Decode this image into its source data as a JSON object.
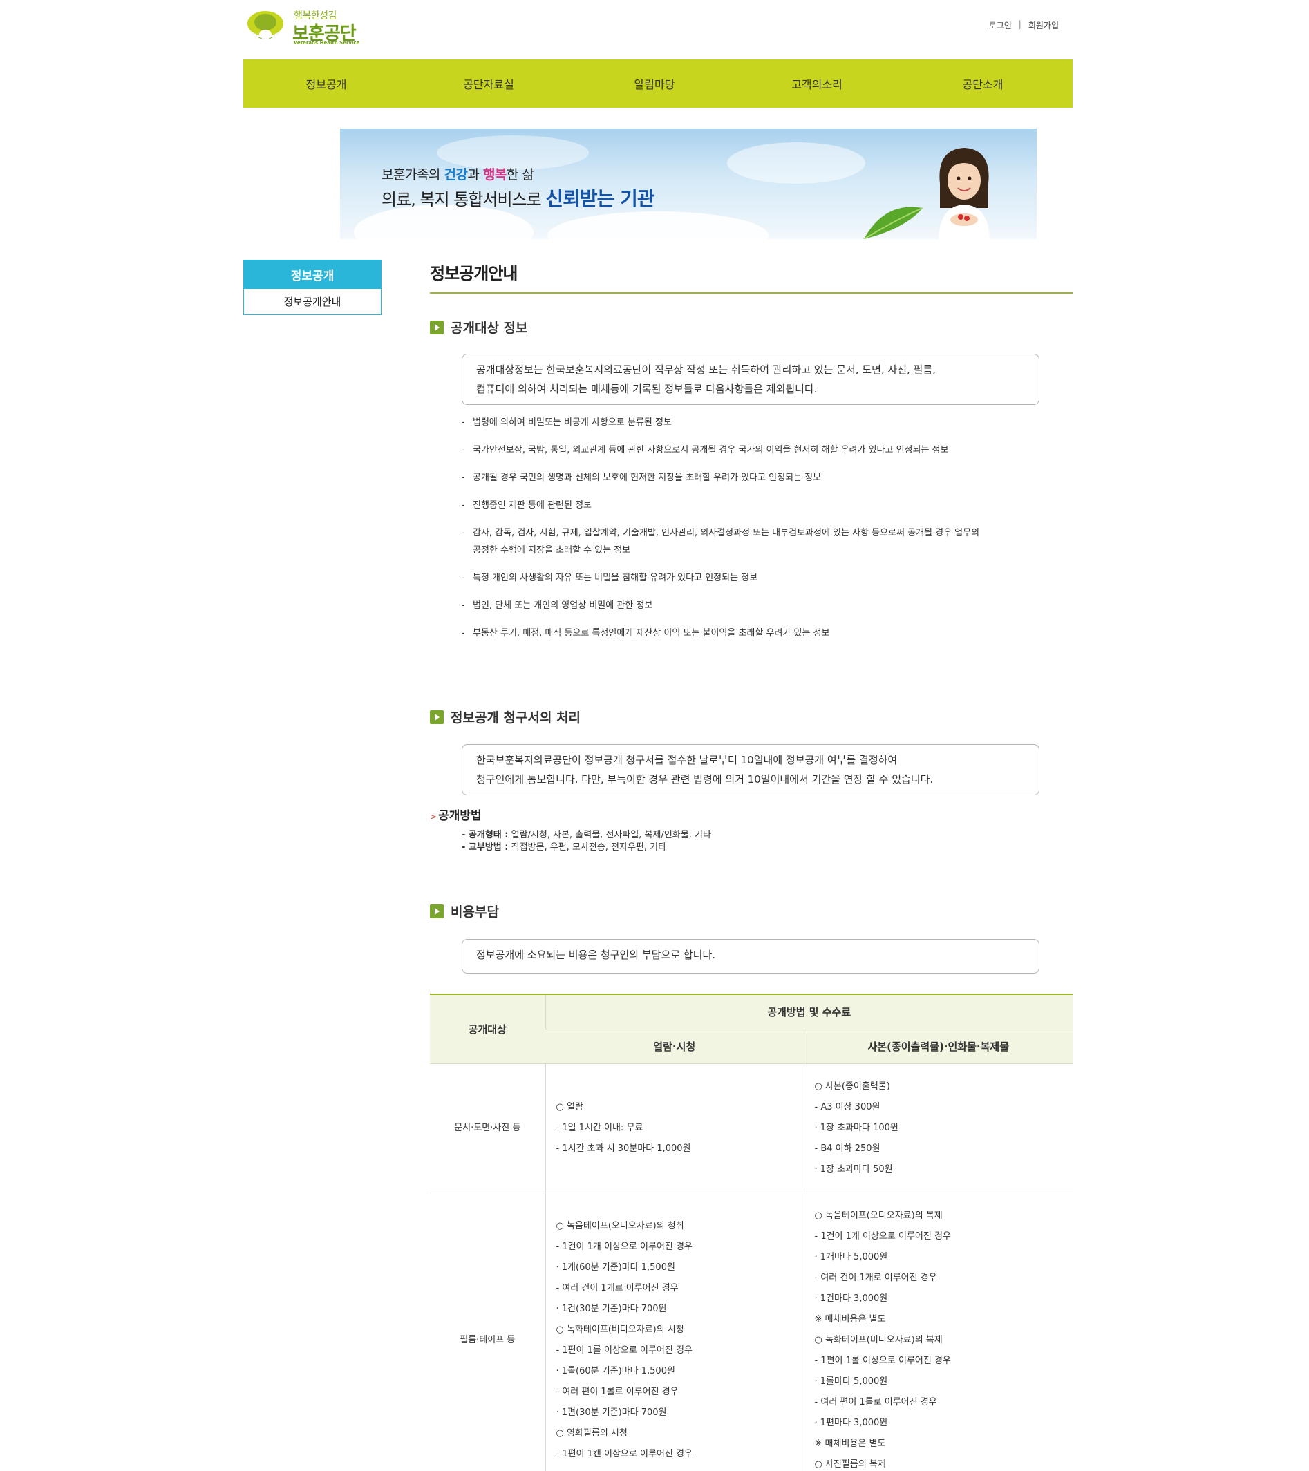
{
  "header": {
    "logo_slogan": "행복한성김",
    "logo_name": "보훈공단",
    "logo_en": "Veterans Health Service",
    "login": "로그인",
    "separator": "|",
    "join": "회원가입"
  },
  "nav": [
    "정보공개",
    "공단자료실",
    "알림마당",
    "고객의소리",
    "공단소개"
  ],
  "banner": {
    "line1_a": "보훈가족의 ",
    "line1_b": "건강",
    "line1_c": "과 ",
    "line1_d": "행복",
    "line1_e": "한 삶",
    "line2_a": "의료, 복지 통합서비스로 ",
    "line2_b": "신뢰받는 기관"
  },
  "sidebar": {
    "title": "정보공개",
    "item": "정보공개안내"
  },
  "page_title": "정보공개안내",
  "section1": {
    "title": "공개대상 정보",
    "box_line1": "공개대상정보는 한국보훈복지의료공단이 직무상 작성 또는 취득하여 관리하고 있는 문서, 도면, 사진, 필름,",
    "box_line2": "컴퓨터에 의하여 처리되는 매체등에 기록된 정보들로 다음사항들은 제외됩니다.",
    "items": [
      "법령에 의하여 비밀또는 비공개 사항으로 분류된 정보",
      "국가안전보장, 국방, 통일, 외교관계 등에 관한 사항으로서 공개될 경우 국가의 이익을 현저히 해할 우려가 있다고 인정되는 정보",
      "공개될 경우 국민의 생명과 신체의 보호에 현저한 지장을 초래할 우려가 있다고 인정되는 정보",
      "진행중인 재판 등에 관련된 정보",
      "감사, 감독, 검사, 시험, 규제, 입찰계약, 기술개발, 인사관리, 의사결정과정 또는 내부검토과정에 있는 사항 등으로써 공개될 경우 업무의 공정한 수행에 지장을 초래할 수 있는 정보",
      "특정 개인의 사생활의 자유 또는 비밀을 침해할 유려가 있다고 인정되는 정보",
      "법인, 단체 또는 개인의 영업상 비밀에 관한 정보",
      "부동산 투기, 매점, 매식 등으로 특정인에게 재산상 이익 또는 불이익을 초래할 우려가 있는 정보"
    ]
  },
  "section2": {
    "title": "정보공개 청구서의 처리",
    "box_line1": "한국보훈복지의료공단이 정보공개 청구서를 접수한 날로부터 10일내에 정보공개 여부를 결정하여",
    "box_line2": "청구인에게 통보합니다. 다만, 부득이한 경우 관련 법령에 의거 10일이내에서 기간을 연장 할 수 있습니다.",
    "method_prefix": ">",
    "method_title": "공개방법",
    "method1_label": "- 공개형태 :",
    "method1_value": " 열람/시청, 사본, 출력물, 전자파일, 복제/인화물, 기타",
    "method2_label": "- 교부방법 :",
    "method2_value": " 직접방문, 우편, 모사전송, 전자우편, 기타"
  },
  "section3": {
    "title": "비용부담",
    "box_line1": "정보공개에 소요되는 비용은 청구인의 부담으로 합니다."
  },
  "table": {
    "h_target": "공개대상",
    "h_method": "공개방법 및 수수료",
    "h_view": "열람·시청",
    "h_copy": "사본(종이출력물)·인화물·복제물",
    "rows": [
      {
        "target": "문서·도면·사진 등",
        "view": [
          "○ 열람",
          "- 1일 1시간 이내: 무료",
          "- 1시간 초과 시 30분마다 1,000원"
        ],
        "copy": [
          "○ 사본(종이출력물)",
          "- A3 이상 300원",
          "· 1장 초과마다 100원",
          "- B4 이하 250원",
          "· 1장 초과마다 50원"
        ]
      },
      {
        "target": "필름·테이프 등",
        "view": [
          "○ 녹음테이프(오디오자료)의 청취",
          "- 1건이 1개 이상으로 이루어진 경우",
          "· 1개(60분 기준)마다 1,500원",
          "- 여러 건이 1개로 이루어진 경우",
          "· 1건(30분 기준)마다 700원",
          "○ 녹화테이프(비디오자료)의 시청",
          "- 1편이 1롤 이상으로 이루어진 경우",
          "· 1롤(60분 기준)마다 1,500원",
          "- 여러 편이 1롤로 이루어진 경우",
          "· 1편(30분 기준)마다 700원",
          "○ 영화필름의 시청",
          "- 1편이 1캔 이상으로 이루어진 경우"
        ],
        "copy": [
          "○ 녹음테이프(오디오자료)의 복제",
          "- 1건이 1개 이상으로 이루어진 경우",
          "· 1개마다 5,000원",
          "- 여러 건이 1개로 이루어진 경우",
          "· 1건마다 3,000원",
          "※ 매체비용은 별도",
          "○ 녹화테이프(비디오자료)의 복제",
          "- 1편이 1롤 이상으로 이루어진 경우",
          "· 1롤마다 5,000원",
          "- 여러 편이 1롤로 이루어진 경우",
          "· 1편마다 3,000원",
          "※ 매체비용은 별도",
          "○ 사진필름의 복제"
        ]
      }
    ]
  }
}
